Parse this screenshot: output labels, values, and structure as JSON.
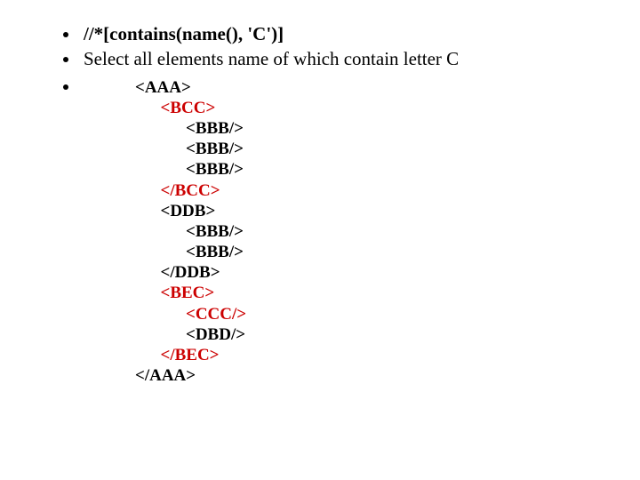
{
  "bullets": {
    "xpath": "//*[contains(name(), 'C')]",
    "description": "Select all elements name of which contain letter C"
  },
  "code": {
    "lines": [
      {
        "indent": 0,
        "text": "<AAA>",
        "hl": false
      },
      {
        "indent": 1,
        "text": "<BCC>",
        "hl": true
      },
      {
        "indent": 2,
        "text": "<BBB/>",
        "hl": false
      },
      {
        "indent": 2,
        "text": "<BBB/>",
        "hl": false
      },
      {
        "indent": 2,
        "text": "<BBB/>",
        "hl": false
      },
      {
        "indent": 1,
        "text": "</BCC>",
        "hl": true
      },
      {
        "indent": 1,
        "text": "<DDB>",
        "hl": false
      },
      {
        "indent": 2,
        "text": "<BBB/>",
        "hl": false
      },
      {
        "indent": 2,
        "text": "<BBB/>",
        "hl": false
      },
      {
        "indent": 1,
        "text": "</DDB>",
        "hl": false
      },
      {
        "indent": 1,
        "text": "<BEC>",
        "hl": true
      },
      {
        "indent": 2,
        "text": "<CCC/>",
        "hl": true
      },
      {
        "indent": 2,
        "text": "<DBD/>",
        "hl": false
      },
      {
        "indent": 1,
        "text": "</BEC>",
        "hl": true
      },
      {
        "indent": 0,
        "text": "</AAA>",
        "hl": false
      }
    ],
    "indent_unit": "      "
  }
}
